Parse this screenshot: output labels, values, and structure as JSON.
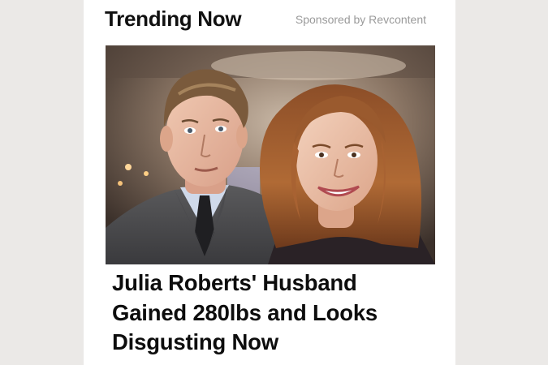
{
  "widget": {
    "heading": "Trending Now",
    "sponsor_label": "Sponsored by Revcontent"
  },
  "article": {
    "image_icon": "photo-couple-image",
    "headline": "Julia Roberts' Husband Gained 280lbs and Looks Disgusting Now"
  },
  "colors": {
    "page_background": "#ebe9e7",
    "card_background": "#ffffff",
    "heading_text": "#111111",
    "sponsor_text": "#9a9a9a"
  }
}
